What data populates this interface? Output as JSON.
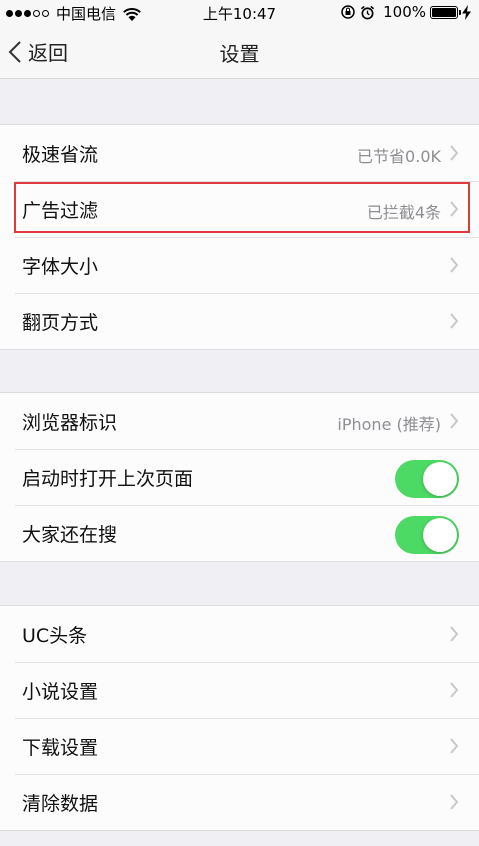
{
  "status_bar": {
    "carrier": "中国电信",
    "time": "上午10:47",
    "battery_percent": "100%",
    "battery_level": 1.0,
    "signal_bars_filled": 3,
    "signal_bars_total": 5,
    "icons": [
      "wifi-icon",
      "rotation-lock-icon",
      "alarm-icon",
      "charging-icon"
    ]
  },
  "nav": {
    "back_label": "返回",
    "title": "设置"
  },
  "groups": [
    {
      "rows": [
        {
          "label": "极速省流",
          "value": "已节省0.0K",
          "accessory": "chevron"
        },
        {
          "label": "广告过滤",
          "value": "已拦截4条",
          "accessory": "chevron",
          "highlighted": true
        },
        {
          "label": "字体大小",
          "value": "",
          "accessory": "chevron"
        },
        {
          "label": "翻页方式",
          "value": "",
          "accessory": "chevron"
        }
      ]
    },
    {
      "rows": [
        {
          "label": "浏览器标识",
          "value": "iPhone (推荐)",
          "accessory": "chevron"
        },
        {
          "label": "启动时打开上次页面",
          "accessory": "toggle",
          "on": true
        },
        {
          "label": "大家还在搜",
          "accessory": "toggle",
          "on": true
        }
      ]
    },
    {
      "rows": [
        {
          "label": "UC头条",
          "value": "",
          "accessory": "chevron"
        },
        {
          "label": "小说设置",
          "value": "",
          "accessory": "chevron"
        },
        {
          "label": "下载设置",
          "value": "",
          "accessory": "chevron"
        },
        {
          "label": "清除数据",
          "value": "",
          "accessory": "chevron"
        }
      ]
    }
  ],
  "colors": {
    "toggle_on": "#4cd964",
    "highlight": "#e0393e",
    "background": "#efeff4",
    "value_text": "#8e8e93"
  }
}
